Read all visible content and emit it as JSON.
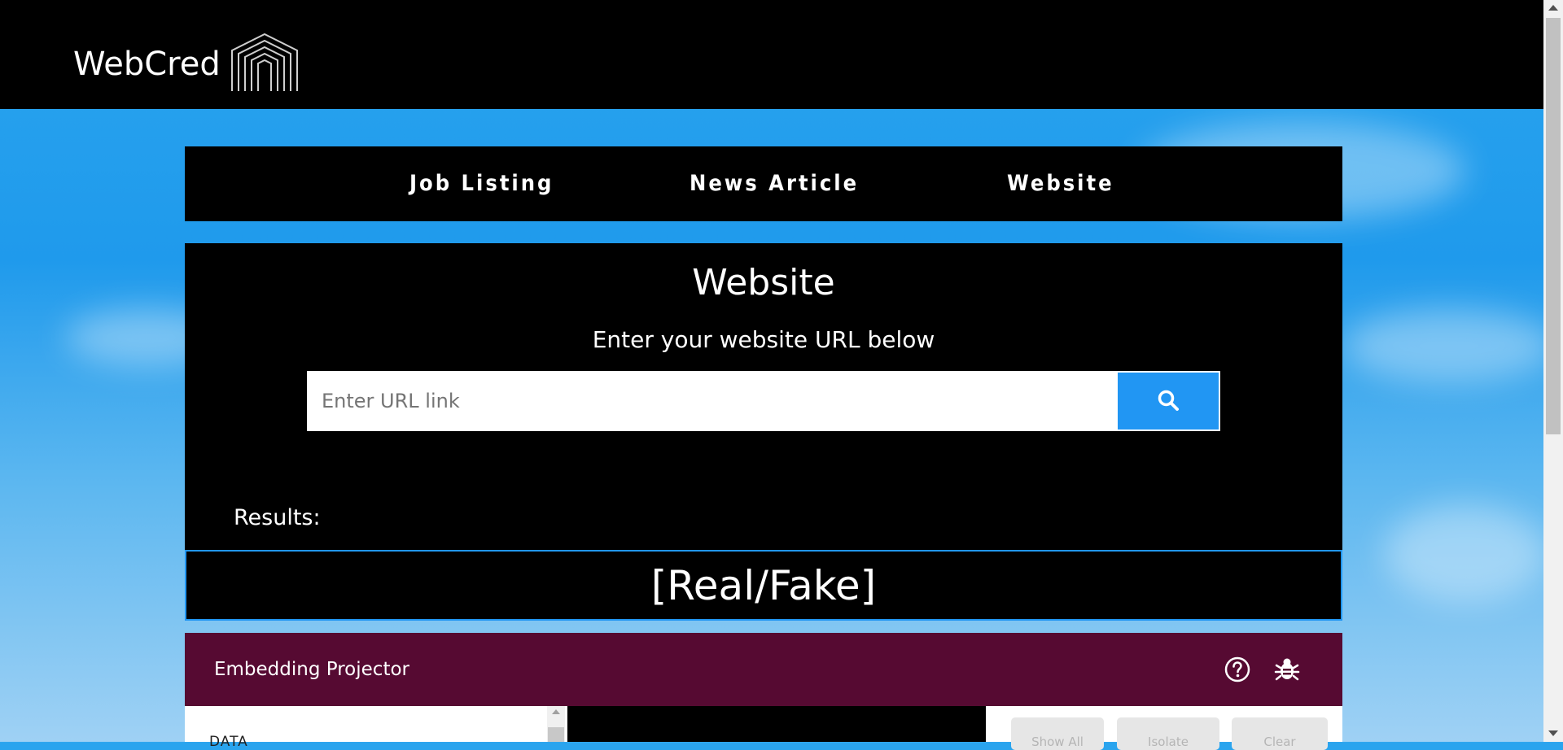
{
  "brand": {
    "name": "WebCred"
  },
  "nav": {
    "items": [
      {
        "label": "Job Listing"
      },
      {
        "label": "News Article"
      },
      {
        "label": "Website"
      }
    ]
  },
  "panel": {
    "title": "Website",
    "subtitle": "Enter your website URL below",
    "search": {
      "placeholder": "Enter URL link",
      "value": ""
    },
    "results_label": "Results:",
    "result_value": "[Real/Fake]"
  },
  "projector": {
    "title": "Embedding Projector",
    "data_label": "DATA",
    "buttons": [
      {
        "label": "Show All"
      },
      {
        "label": "Isolate"
      },
      {
        "label": "Clear"
      }
    ]
  },
  "colors": {
    "accent": "#2196f3",
    "projector_header": "#560a32",
    "bar": "#000000"
  },
  "icons": {
    "search": "search-icon",
    "help": "help-icon",
    "bug": "bug-icon",
    "logo": "webcred-logo-icon"
  }
}
